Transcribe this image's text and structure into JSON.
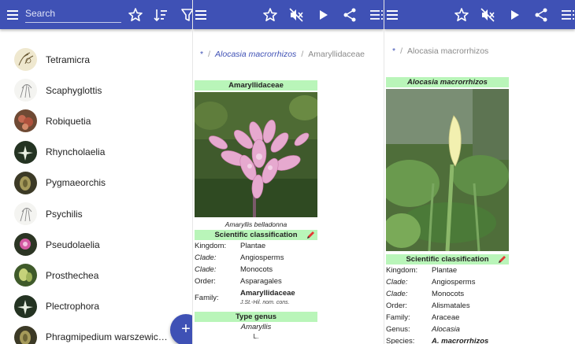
{
  "left_panel": {
    "search_placeholder": "Search",
    "genera": [
      {
        "name": "Tetramicra",
        "thumb": "sketch"
      },
      {
        "name": "Scaphyglottis",
        "thumb": "sketch-light"
      },
      {
        "name": "Robiquetia",
        "thumb": "red"
      },
      {
        "name": "Rhyncholaelia",
        "thumb": "white-dark"
      },
      {
        "name": "Pygmaeorchis",
        "thumb": "olive"
      },
      {
        "name": "Psychilis",
        "thumb": "sketch-light"
      },
      {
        "name": "Pseudolaelia",
        "thumb": "pink"
      },
      {
        "name": "Prosthechea",
        "thumb": "green"
      },
      {
        "name": "Plectrophora",
        "thumb": "white-dark"
      },
      {
        "name": "Phragmipedium warszewic…",
        "thumb": "olive"
      }
    ],
    "fab_label": "+"
  },
  "middle_panel": {
    "breadcrumb": {
      "root": "*",
      "parent": "Alocasia macrorrhizos",
      "current": "Amaryllidaceae"
    },
    "infobox": {
      "title": "Amaryllidaceae",
      "image_caption": "Amaryllis belladonna",
      "classification_header": "Scientific classification",
      "rows": [
        {
          "key": "Kingdom:",
          "value": "Plantae",
          "key_italic": false
        },
        {
          "key": "Clade:",
          "value": "Angiosperms",
          "key_italic": true
        },
        {
          "key": "Clade:",
          "value": "Monocots",
          "key_italic": true
        },
        {
          "key": "Order:",
          "value": "Asparagales",
          "key_italic": false
        }
      ],
      "family_key": "Family:",
      "family_value": "Amaryllidaceae",
      "family_authority": "J.St.-Hil. nom. cons.",
      "type_genus_header": "Type genus",
      "type_genus_value": "Amaryllis",
      "type_genus_author": "L."
    }
  },
  "right_panel": {
    "breadcrumb": {
      "root": "*",
      "current": "Alocasia macrorrhizos"
    },
    "infobox": {
      "title": "Alocasia macrorrhizos",
      "classification_header": "Scientific classification",
      "rows": [
        {
          "key": "Kingdom:",
          "value": "Plantae",
          "key_italic": false,
          "value_italic": false
        },
        {
          "key": "Clade:",
          "value": "Angiosperms",
          "key_italic": true,
          "value_italic": false
        },
        {
          "key": "Clade:",
          "value": "Monocots",
          "key_italic": true,
          "value_italic": false
        },
        {
          "key": "Order:",
          "value": "Alismatales",
          "key_italic": false,
          "value_italic": false
        },
        {
          "key": "Family:",
          "value": "Araceae",
          "key_italic": false,
          "value_italic": false
        },
        {
          "key": "Genus:",
          "value": "Alocasia",
          "key_italic": false,
          "value_italic": true
        },
        {
          "key": "Species:",
          "value": "A. macrorrhizos",
          "key_italic": false,
          "value_italic": true
        }
      ]
    }
  },
  "colors": {
    "app_bar": "#3f51b5",
    "infobox_header": "#b9f5b9",
    "link": "#3f51b5"
  }
}
